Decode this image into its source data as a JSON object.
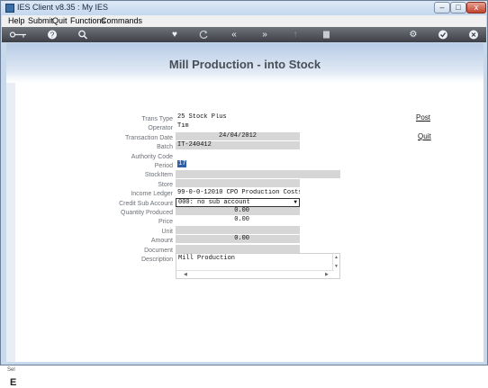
{
  "window": {
    "title": "IES Client v8.35 : My IES",
    "btn_min": "–",
    "btn_max": "□",
    "btn_close": "x"
  },
  "menubar": {
    "items": [
      "Help",
      "Submit",
      "Quit",
      "Functions",
      "Commands"
    ]
  },
  "toolbar": {
    "icons": [
      "key-icon",
      "help-icon",
      "search-icon",
      "heart-icon",
      "refresh-icon",
      "rewind-icon",
      "fast-forward-icon",
      "upload-icon",
      "stop-icon",
      "gear-icon",
      "check-icon",
      "close-icon"
    ]
  },
  "page": {
    "title": "Mill Production - into Stock"
  },
  "left_strip": {
    "text": "Sel",
    "big": "E"
  },
  "form": {
    "trans_type": {
      "label": "Trans Type",
      "value": "25 Stock Plus"
    },
    "operator": {
      "label": "Operator",
      "value": "Tim"
    },
    "transaction_date": {
      "label": "Transaction Date",
      "value": "24/04/2012"
    },
    "batch": {
      "label": "Batch",
      "value": "IT-240412"
    },
    "authority_code": {
      "label": "Authority Code",
      "value": ""
    },
    "period": {
      "label": "Period",
      "value": "17"
    },
    "stockitem": {
      "label": "StockItem",
      "value": ""
    },
    "store": {
      "label": "Store",
      "value": ""
    },
    "income_ledger": {
      "label": "Income Ledger",
      "value": "99-0-0-12010 CPO Production Costs"
    },
    "credit_sub_account": {
      "label": "Credit Sub Account",
      "value": "000: no sub account"
    },
    "quantity_produced": {
      "label": "Quantity Produced",
      "value": "0.00"
    },
    "price": {
      "label": "Price",
      "value": "0.00"
    },
    "unit": {
      "label": "Unit",
      "value": ""
    },
    "amount": {
      "label": "Amount",
      "value": "0.00"
    },
    "document": {
      "label": "Document",
      "value": ""
    },
    "description": {
      "label": "Description",
      "value": "Mill Production"
    }
  },
  "actions": {
    "post": "Post",
    "quit": "Quit"
  },
  "colors": {
    "accent": "#2e5fa8",
    "toolbar": "#4a4e54",
    "field_shaded": "#d6d6d6",
    "header_band": "#b7cce6"
  }
}
